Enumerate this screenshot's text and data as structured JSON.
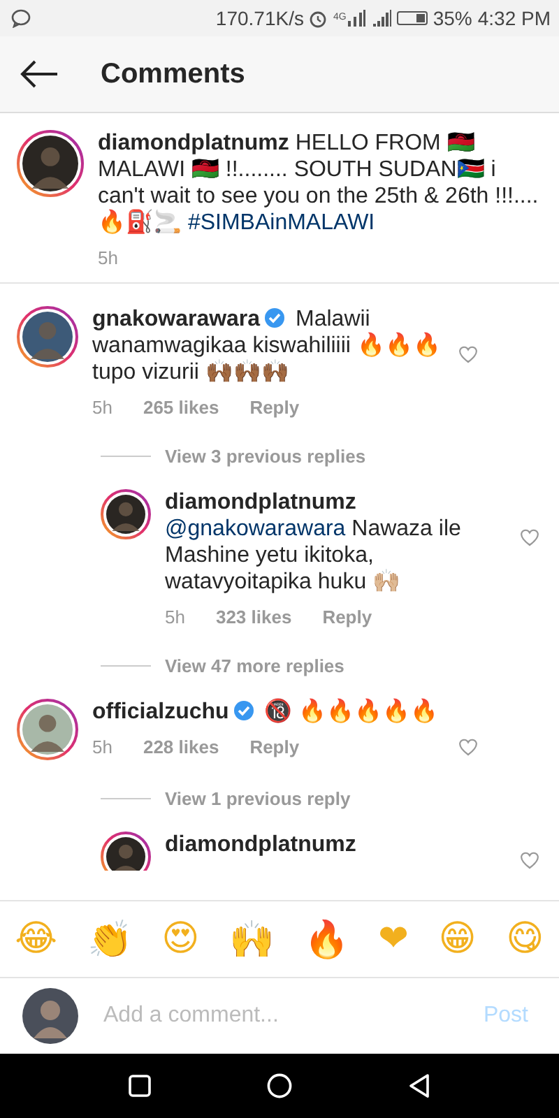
{
  "status_bar": {
    "speed": "170.71K/s",
    "network": "4G",
    "battery": "35%",
    "time": "4:32 PM"
  },
  "header": {
    "title": "Comments"
  },
  "caption": {
    "username": "diamondplatnumz",
    "text": "HELLO FROM 🇲🇼 MALAWI 🇲🇼 !!........ SOUTH SUDAN🇸🇸 i can't wait to see you on the 25th & 26th !!!.... 🔥⛽🚬 ",
    "hashtag": "#SIMBAinMALAWI",
    "time": "5h"
  },
  "comments": [
    {
      "kind": "comment",
      "username": "gnakowarawara",
      "verified": true,
      "text": "Malawii wanamwagikaa kiswahiliiii 🔥🔥🔥 tupo vizurii 🙌🏾🙌🏾🙌🏾",
      "time": "5h",
      "likes": "265 likes",
      "reply": "Reply"
    },
    {
      "kind": "more",
      "label": "View 3 previous replies"
    },
    {
      "kind": "reply",
      "username": "diamondplatnumz",
      "verified": false,
      "mention": "@gnakowarawara",
      "text": " Nawaza ile Mashine yetu ikitoka, watavyoitapika huku 🙌🏼",
      "time": "5h",
      "likes": "323 likes",
      "reply": "Reply"
    },
    {
      "kind": "more",
      "label": "View 47 more replies"
    },
    {
      "kind": "comment",
      "username": "officialzuchu",
      "verified": true,
      "text": "🔞 🔥🔥🔥🔥🔥",
      "time": "5h",
      "likes": "228 likes",
      "reply": "Reply"
    },
    {
      "kind": "more",
      "label": "View 1 previous reply"
    },
    {
      "kind": "reply",
      "username": "diamondplatnumz",
      "verified": false
    }
  ],
  "emoji_bar": [
    "😂",
    "👏",
    "😍",
    "🙌",
    "🔥",
    "❤",
    "😁",
    "😋"
  ],
  "composer": {
    "placeholder": "Add a comment...",
    "post": "Post"
  }
}
